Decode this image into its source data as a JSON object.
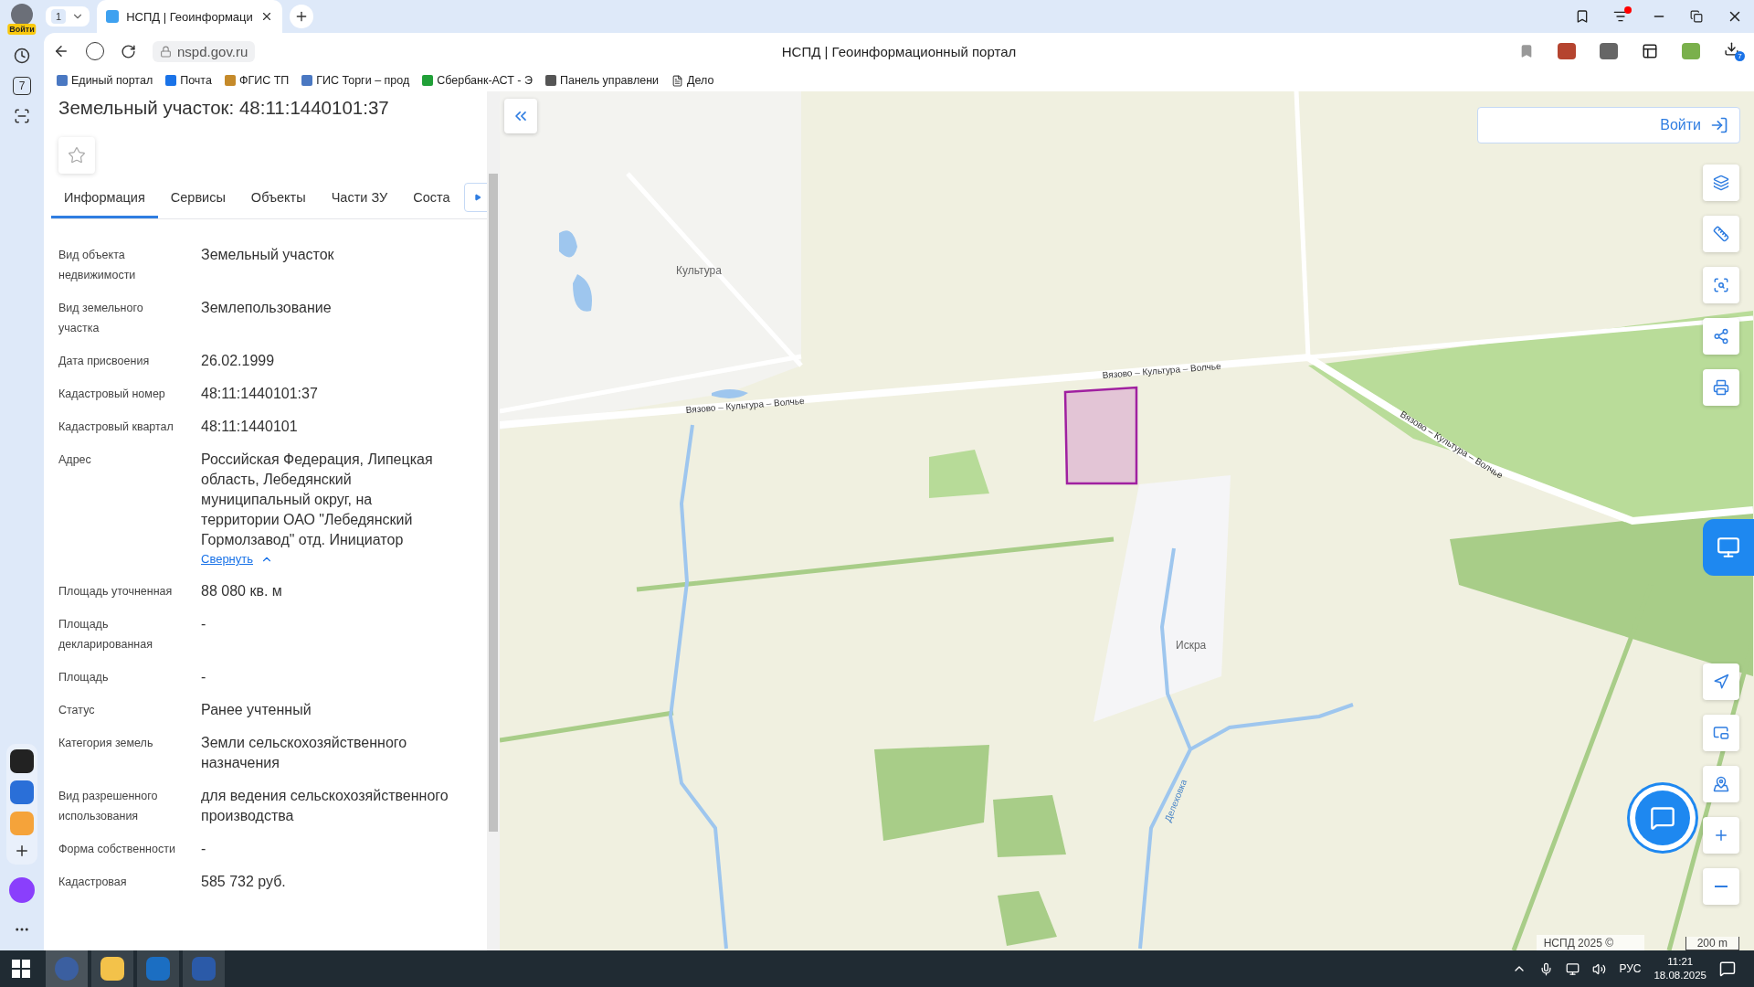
{
  "browser": {
    "profile_badge": "Войти",
    "tab_count": "1",
    "tabs": [
      {
        "title": "НСПД | Геоинформаци",
        "selected": true
      }
    ],
    "url": "nspd.gov.ru",
    "page_title": "НСПД | Геоинформационный портал",
    "download_count": "7",
    "calendar_day": "7",
    "bookmarks": [
      {
        "label": "Единый портал"
      },
      {
        "label": "Почта"
      },
      {
        "label": "ФГИС ТП"
      },
      {
        "label": "ГИС Торги – прод"
      },
      {
        "label": "Сбербанк-АСТ - Э"
      },
      {
        "label": "Панель управлени"
      },
      {
        "label": "Дело"
      }
    ]
  },
  "panel": {
    "title": "Земельный участок: 48:11:1440101:37",
    "favorite": false,
    "tabs": [
      {
        "label": "Информация",
        "selected": true
      },
      {
        "label": "Сервисы",
        "selected": false
      },
      {
        "label": "Объекты",
        "selected": false
      },
      {
        "label": "Части ЗУ",
        "selected": false
      },
      {
        "label": "Соста",
        "selected": false
      }
    ],
    "fields": [
      {
        "label": "Вид объекта недвижимости",
        "value": "Земельный участок"
      },
      {
        "label": "Вид земельного участка",
        "value": "Землепользование"
      },
      {
        "label": "Дата присвоения",
        "value": "26.02.1999"
      },
      {
        "label": "Кадастровый номер",
        "value": "48:11:1440101:37"
      },
      {
        "label": "Кадастровый квартал",
        "value": "48:11:1440101"
      },
      {
        "label": "Адрес",
        "value": "Российская Федерация, Липецкая область, Лебедянский муниципальный округ, на территории ОАО \"Лебедянский Гормолзавод\" отд. Инициатор",
        "link": "Свернуть"
      },
      {
        "label": "Площадь уточненная",
        "value": "88 080 кв. м"
      },
      {
        "label": "Площадь декларированная",
        "value": "-"
      },
      {
        "label": "Площадь",
        "value": "-"
      },
      {
        "label": "Статус",
        "value": "Ранее учтенный"
      },
      {
        "label": "Категория земель",
        "value": "Земли сельскохозяйственного назначения"
      },
      {
        "label": "Вид разрешенного использования",
        "value": "для ведения сельскохозяйственного производства"
      },
      {
        "label": "Форма собственности",
        "value": "-"
      },
      {
        "label": "Кадастровая",
        "value": "585 732 руб."
      }
    ]
  },
  "map": {
    "login_button": "Войти",
    "attribution": "НСПД 2025 ©",
    "scale": "200 m",
    "labels": [
      {
        "text": "Культура",
        "kind": "settlement"
      },
      {
        "text": "Вязово – Культура – Волчье",
        "kind": "road"
      },
      {
        "text": "Вязово – Культура – Волчье",
        "kind": "road"
      },
      {
        "text": "Вязово – Культура – Волчье",
        "kind": "road"
      },
      {
        "text": "Искра",
        "kind": "settlement"
      },
      {
        "text": "Делеховка",
        "kind": "river"
      }
    ]
  },
  "taskbar": {
    "language": "РУС",
    "time": "11:21",
    "date": "18.08.2025"
  }
}
